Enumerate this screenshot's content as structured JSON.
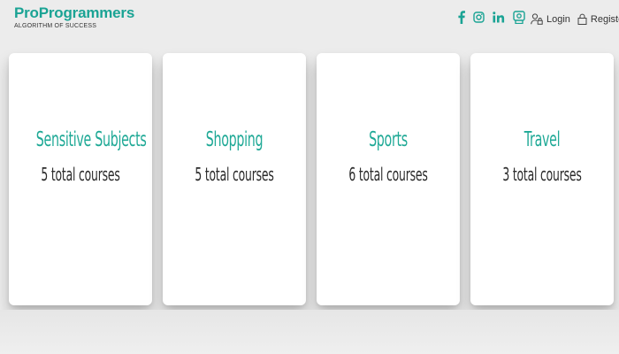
{
  "header": {
    "brand_name": "ProProgrammers",
    "brand_tagline": "ALGORITHM OF SUCCESS",
    "social_icons": [
      "facebook-icon",
      "instagram-icon",
      "linkedin-icon",
      "certificate-icon"
    ],
    "login_label": "Login",
    "register_label": "Register",
    "accent_color": "#1aa394"
  },
  "categories": [
    {
      "title": "Sensitive Subjects",
      "count": "5 total courses"
    },
    {
      "title": "Shopping",
      "count": "5 total courses"
    },
    {
      "title": "Sports",
      "count": "6 total courses"
    },
    {
      "title": "Travel",
      "count": "3 total courses"
    }
  ]
}
